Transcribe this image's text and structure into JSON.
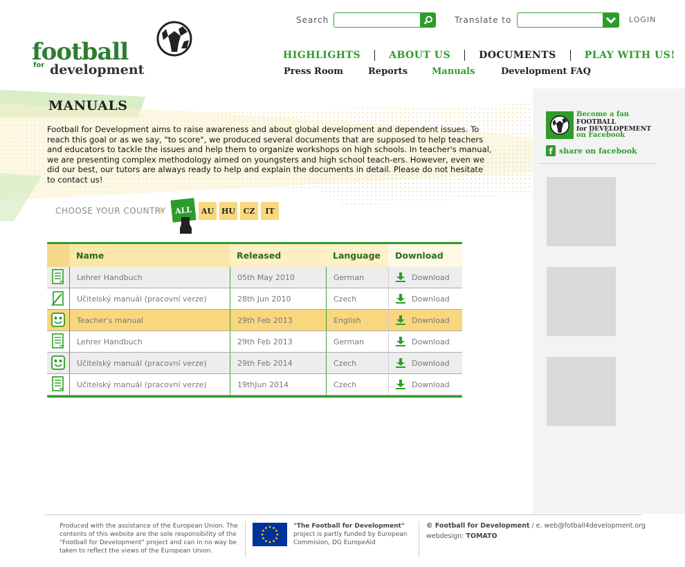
{
  "header": {
    "logo_line1": "football",
    "logo_for": "for",
    "logo_line2": "development",
    "search_label": "Search",
    "search_value": "",
    "translate_label": "Translate to",
    "translate_value": "",
    "login": "LOGIN"
  },
  "nav": {
    "primary": [
      {
        "label": "HIGHLIGHTS",
        "color": "#2d9c2a"
      },
      {
        "label": "ABOUT US",
        "color": "#2d9c2a"
      },
      {
        "label": "DOCUMENTS",
        "color": "#222222"
      },
      {
        "label": "PLAY WITH US!",
        "color": "#2d9c2a"
      }
    ],
    "secondary": [
      {
        "label": "Press Room",
        "active": false
      },
      {
        "label": "Reports",
        "active": false
      },
      {
        "label": "Manuals",
        "active": true
      },
      {
        "label": "Development FAQ",
        "active": false
      }
    ]
  },
  "main": {
    "title": "MANUALS",
    "intro": "Football for Development aims to raise awareness and about global development and dependent issues. To reach this goal or as we say, \"to score\", we produced several documents that are supposed to help teachers and educators to tackle the issues and help them to organize workshops on high schools. In teacher's manual, we are presenting complex methodology aimed on youngsters and high school teach-ers. However, even we did our best, our tutors are always ready to help and explain the documents in detail. Please do not hesitate to contact us!",
    "choose_label": "CHOOSE YOUR COUNTRY",
    "countries": [
      "ALL",
      "AU",
      "HU",
      "CZ",
      "IT"
    ],
    "selected_country": "ALL"
  },
  "table": {
    "headers": [
      "Name",
      "Released",
      "Language",
      "Download"
    ],
    "rows": [
      {
        "icon": "document-icon",
        "name": "Lehrer Handbuch",
        "released": "05th May 2010",
        "language": "German",
        "download": "Download",
        "style": "alt"
      },
      {
        "icon": "pencil-icon",
        "name": "Učitelský manuál (pracovní verze)",
        "released": "28th Jun 2010",
        "language": "Czech",
        "download": "Download",
        "style": "normal"
      },
      {
        "icon": "smiley-icon",
        "name": "Teacher's manual",
        "released": "29th Feb 2013",
        "language": "English",
        "download": "Download",
        "style": "highlight"
      },
      {
        "icon": "document-icon",
        "name": "Lehrer Handbuch",
        "released": "29th Feb 2013",
        "language": "German",
        "download": "Download",
        "style": "normal"
      },
      {
        "icon": "smiley-icon",
        "name": "Učitelský manuál (pracovní verze)",
        "released": "29th Feb 2014",
        "language": "Czech",
        "download": "Download",
        "style": "alt"
      },
      {
        "icon": "document-icon",
        "name": "Učitelský manuál (pracovní verze)",
        "released": "19thJun 2014",
        "language": "Czech",
        "download": "Download",
        "style": "normal"
      }
    ]
  },
  "sidebar": {
    "fb_line1": "Become a fan",
    "fb_line2": "FOOTBALL",
    "fb_line3": "for DEVELOPEMENT",
    "fb_line4": "on Facebook",
    "share": "share on facebook"
  },
  "footer": {
    "disclaimer": "Produced with the assistance of the European Union. The contents of this website are the sole responsibility of the \"Football for Development\" project and can in no way be taken to reflect the views of the European Union.",
    "eu_title": "\"The Football for Development\"",
    "eu_text": "project is partly funded by European Commision, DG EuropeAid",
    "copyright_name": "© Football for Development",
    "copyright_email": " / e. web@fotball4development.org",
    "webdesign_label": "webdesign: ",
    "webdesign_name": "TOMATO"
  },
  "colors": {
    "accent": "#2d9c2a",
    "highlight": "#f9d77e",
    "text": "#222222"
  }
}
